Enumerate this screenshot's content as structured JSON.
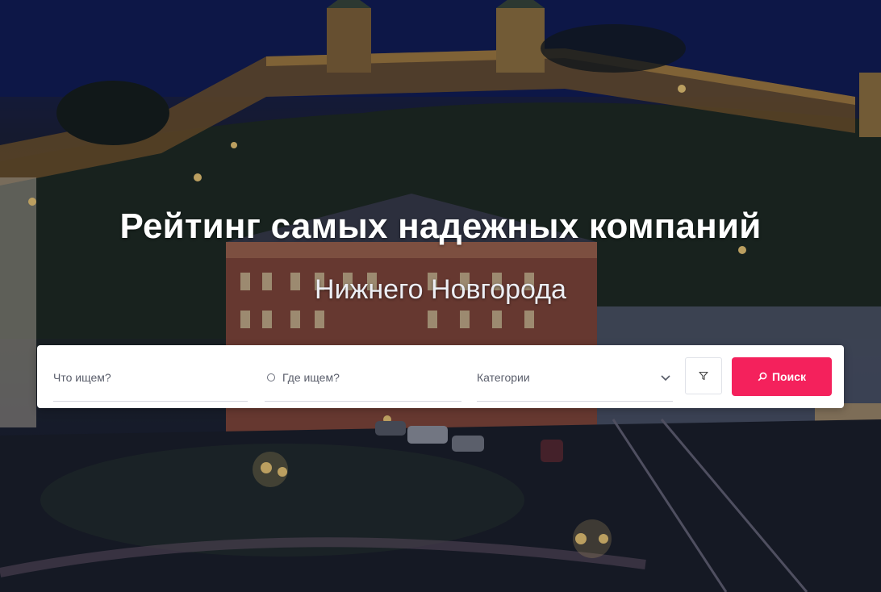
{
  "hero": {
    "title": "Рейтинг самых надежных компаний",
    "subtitle": "Нижнего Новгорода"
  },
  "search": {
    "what_placeholder": "Что ищем?",
    "where_placeholder": "Где ищем?",
    "category_label": "Категории",
    "filter_icon": "filter-icon",
    "submit_label": "Поиск",
    "submit_icon": "search-icon"
  },
  "colors": {
    "accent": "#f4215c",
    "background": "#ffffff"
  }
}
